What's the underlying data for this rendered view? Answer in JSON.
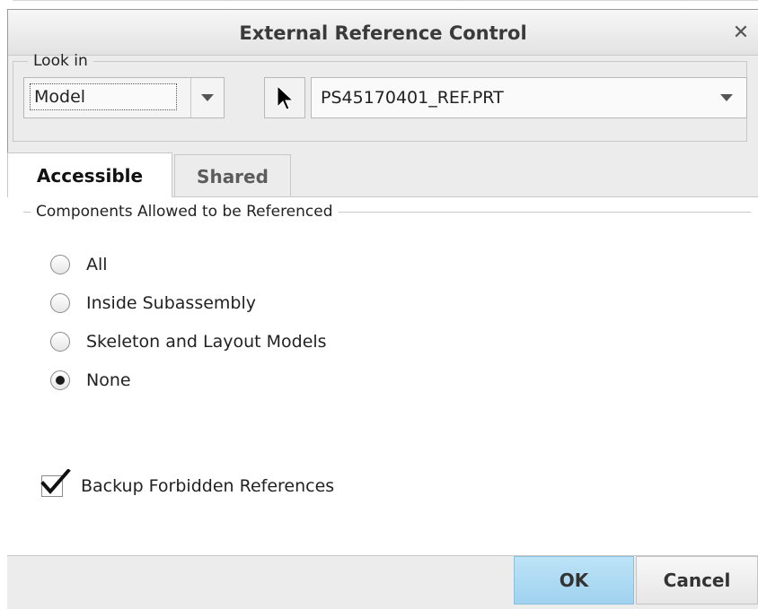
{
  "dialog": {
    "title": "External Reference Control",
    "close_label": "✕"
  },
  "look_in": {
    "legend": "Look in",
    "scope_value": "Model",
    "reference_value": "PS45170401_REF.PRT"
  },
  "tabs": [
    {
      "label": "Accessible",
      "active": true
    },
    {
      "label": "Shared",
      "active": false
    }
  ],
  "components": {
    "legend": "Components Allowed to be Referenced",
    "options": [
      {
        "label": "All",
        "selected": false
      },
      {
        "label": "Inside Subassembly",
        "selected": false
      },
      {
        "label": "Skeleton and Layout Models",
        "selected": false
      },
      {
        "label": "None",
        "selected": true
      }
    ]
  },
  "backup": {
    "label": "Backup Forbidden References",
    "checked": true
  },
  "buttons": {
    "ok": "OK",
    "cancel": "Cancel"
  },
  "colors": {
    "ok_button": "#a8d8f2",
    "dialog_bg": "#ececec"
  }
}
